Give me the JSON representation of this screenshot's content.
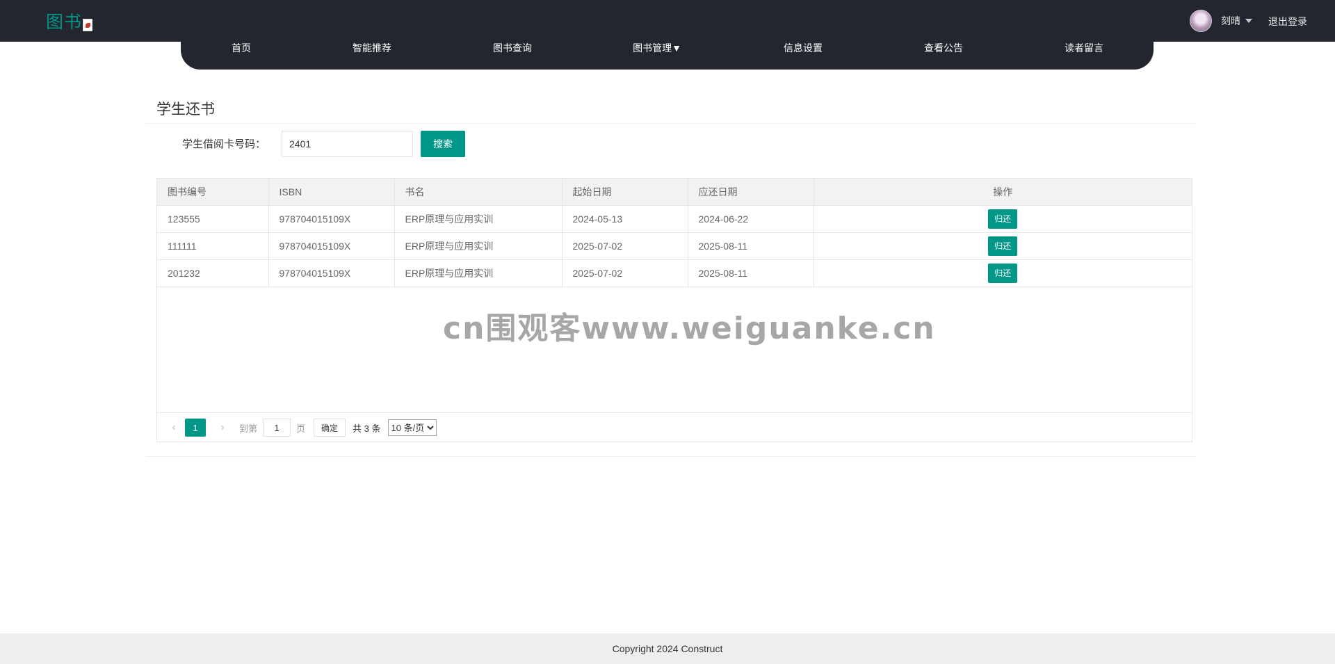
{
  "header": {
    "logo_text": "图书",
    "user_name": "刻晴",
    "logout_label": "退出登录",
    "nav": [
      {
        "label": "首页"
      },
      {
        "label": "智能推荐"
      },
      {
        "label": "图书查询"
      },
      {
        "label": "图书管理▼"
      },
      {
        "label": "信息设置"
      },
      {
        "label": "查看公告"
      },
      {
        "label": "读者留言"
      }
    ]
  },
  "page": {
    "title": "学生还书",
    "search": {
      "label": "学生借阅卡号码：",
      "value": "2401",
      "button_label": "搜索"
    }
  },
  "table": {
    "columns": [
      "图书编号",
      "ISBN",
      "书名",
      "起始日期",
      "应还日期",
      "操作"
    ],
    "rows": [
      {
        "id": "123555",
        "isbn": "978704015109X",
        "name": "ERP原理与应用实训",
        "start": "2024-05-13",
        "due": "2024-06-22",
        "action": "归还"
      },
      {
        "id": "111111",
        "isbn": "978704015109X",
        "name": "ERP原理与应用实训",
        "start": "2025-07-02",
        "due": "2025-08-11",
        "action": "归还"
      },
      {
        "id": "201232",
        "isbn": "978704015109X",
        "name": "ERP原理与应用实训",
        "start": "2025-07-02",
        "due": "2025-08-11",
        "action": "归还"
      }
    ]
  },
  "pagination": {
    "current_page": "1",
    "goto_prefix": "到第",
    "goto_value": "1",
    "goto_suffix": "页",
    "confirm_label": "确定",
    "total_text": "共 3 条",
    "page_size_options": [
      "10 条/页"
    ],
    "page_size_selected": "10 条/页"
  },
  "watermark_text": "cn围观客www.weiguanke.cn",
  "footer": {
    "copyright": "Copyright 2024 Construct"
  },
  "colors": {
    "accent": "#009688",
    "header_bg": "#23262e",
    "footer_bg": "#eeeeee"
  }
}
